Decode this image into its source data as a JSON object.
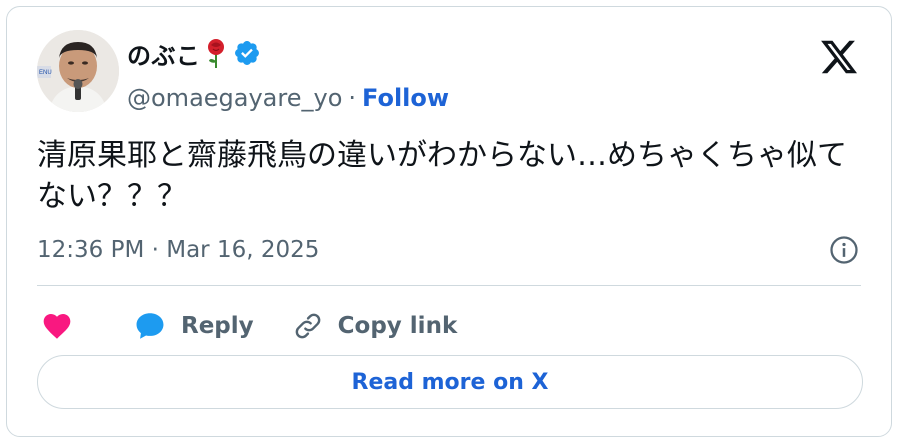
{
  "author": {
    "display_name": "のぶこ",
    "handle": "@omaegayare_yo",
    "separator": "·",
    "follow_label": "Follow"
  },
  "tweet": {
    "text": "清原果耶と齋藤飛鳥の違いがわからない…めちゃくちゃ似てない？？？",
    "timestamp": "12:36 PM · Mar 16, 2025"
  },
  "actions": {
    "reply_label": "Reply",
    "copy_link_label": "Copy link"
  },
  "read_more_label": "Read more on X",
  "icons": {
    "rose": "rose-emoji",
    "verified": "verified-badge",
    "x_logo": "x-logo",
    "info": "info-icon",
    "heart": "heart-icon",
    "reply": "reply-bubble-icon",
    "copy": "link-icon"
  },
  "colors": {
    "link_blue": "#1d63d6",
    "verified_blue": "#1d9bf0",
    "heart_pink": "#f91880",
    "secondary_text": "#536471",
    "border": "#cfd9de"
  }
}
